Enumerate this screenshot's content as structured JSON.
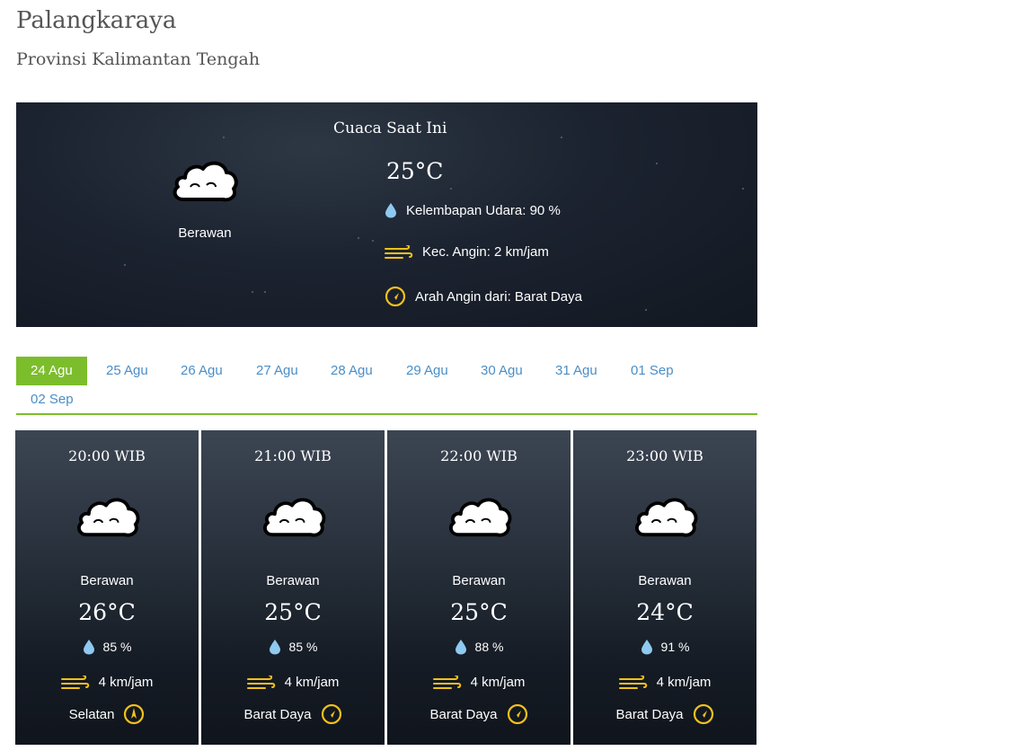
{
  "location": {
    "city": "Palangkaraya",
    "province": "Provinsi Kalimantan Tengah"
  },
  "current": {
    "title": "Cuaca Saat Ini",
    "icon": "cloud-icon",
    "condition": "Berawan",
    "temperature": "25°C",
    "humidity": "Kelembapan Udara: 90 %",
    "wind_speed": "Kec. Angin: 2 km/jam",
    "wind_direction": "Arah Angin dari: Barat Daya"
  },
  "tabs": [
    {
      "label": "24 Agu",
      "active": true
    },
    {
      "label": "25 Agu"
    },
    {
      "label": "26 Agu"
    },
    {
      "label": "27 Agu"
    },
    {
      "label": "28 Agu"
    },
    {
      "label": "29 Agu"
    },
    {
      "label": "30 Agu"
    },
    {
      "label": "31 Agu"
    },
    {
      "label": "01 Sep"
    },
    {
      "label": "02 Sep"
    }
  ],
  "forecast": [
    {
      "time": "20:00 WIB",
      "condition": "Berawan",
      "temperature": "26°C",
      "humidity": "85 %",
      "wind": "4 km/jam",
      "direction": "Selatan"
    },
    {
      "time": "21:00 WIB",
      "condition": "Berawan",
      "temperature": "25°C",
      "humidity": "85 %",
      "wind": "4 km/jam",
      "direction": "Barat Daya"
    },
    {
      "time": "22:00 WIB",
      "condition": "Berawan",
      "temperature": "25°C",
      "humidity": "88 %",
      "wind": "4 km/jam",
      "direction": "Barat Daya"
    },
    {
      "time": "23:00 WIB",
      "condition": "Berawan",
      "temperature": "24°C",
      "humidity": "91 %",
      "wind": "4 km/jam",
      "direction": "Barat Daya"
    }
  ],
  "colors": {
    "accent_green": "#7cbd2c",
    "tab_link": "#4a8ec6",
    "icon_yellow": "#f2c11a",
    "drop_blue": "#8ec9f0"
  }
}
